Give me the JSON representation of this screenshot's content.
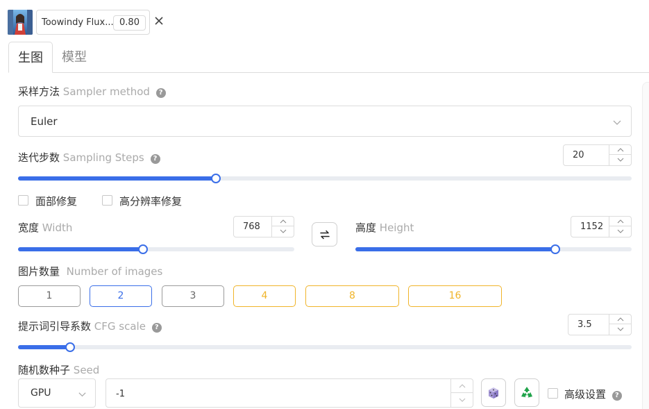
{
  "lora": {
    "name": "Toowindy Flux...",
    "weight": "0.80"
  },
  "tabs": [
    {
      "label": "生图",
      "active": true
    },
    {
      "label": "模型",
      "active": false
    }
  ],
  "sampler": {
    "label_zh": "采样方法",
    "label_en": "Sampler method",
    "value": "Euler"
  },
  "steps": {
    "label_zh": "迭代步数",
    "label_en": "Sampling Steps",
    "value": "20",
    "slider_fraction": 0.322
  },
  "options": {
    "face_restore": "面部修复",
    "hires_fix": "高分辨率修复"
  },
  "width": {
    "label_zh": "宽度",
    "label_en": "Width",
    "value": "768",
    "slider_fraction": 0.452
  },
  "height": {
    "label_zh": "高度",
    "label_en": "Height",
    "value": "1152",
    "slider_fraction": 0.724
  },
  "num_images": {
    "label_zh": "图片数量",
    "label_en": "Number of images",
    "options": [
      "1",
      "2",
      "3",
      "4",
      "8",
      "16"
    ],
    "selected": "2"
  },
  "cfg": {
    "label_zh": "提示词引导系数",
    "label_en": "CFG scale",
    "value": "3.5",
    "slider_fraction": 0.085
  },
  "seed": {
    "label_zh": "随机数种子",
    "label_en": "Seed",
    "device": "GPU",
    "value": "-1"
  },
  "advanced": {
    "label": "高级设置"
  },
  "colors": {
    "accent": "#3a6ee8",
    "vip": "#f0b429"
  }
}
